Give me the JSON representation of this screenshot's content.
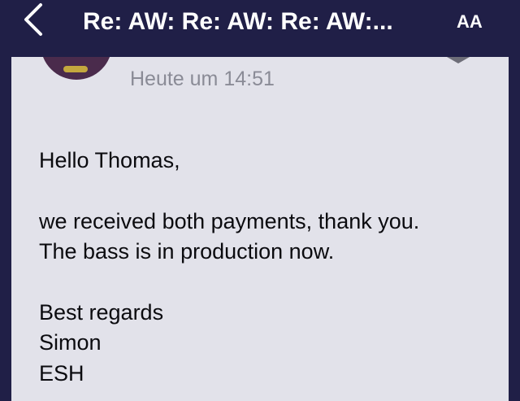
{
  "navbar": {
    "back_icon": "chevron-left-icon",
    "title": "Re: AW: Re: AW: Re: AW:...",
    "text_size_icon": "text-size-icon",
    "text_size_label": "AA"
  },
  "message": {
    "date": "Heute um 14:51",
    "body": {
      "greeting": "Hello Thomas,",
      "line1": "we received both payments, thank you.",
      "line2": "The bass is in production now.",
      "closing": "Best regards",
      "name": "Simon",
      "company": "ESH"
    }
  },
  "colors": {
    "nav_background": "#201f47",
    "content_background": "#e2e2ea",
    "date_text": "#8a8b96",
    "body_text": "#0b0b0f"
  }
}
